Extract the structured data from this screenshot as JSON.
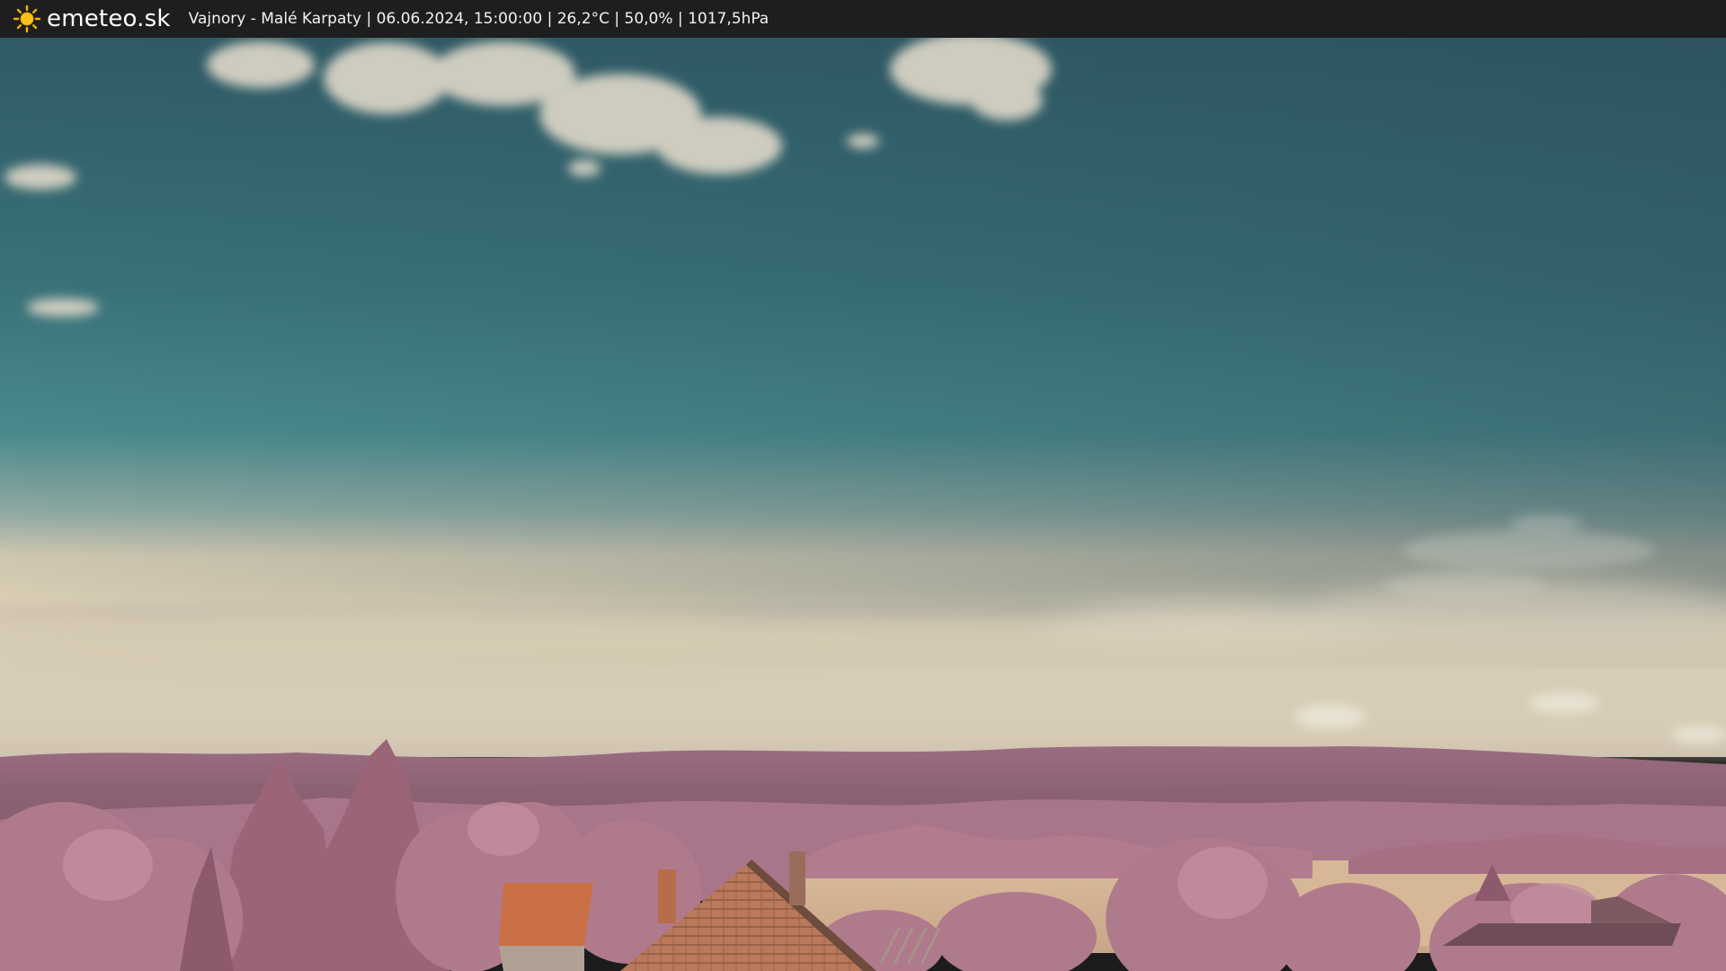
{
  "header": {
    "brand": "emeteo.sk",
    "logo_icon": "sun-icon",
    "location": "Vajnory - Malé Karpaty",
    "datetime": "06.06.2024, 15:00:00",
    "temperature": "26,2°C",
    "humidity": "50,0%",
    "pressure": "1017,5hPa",
    "separator": " | "
  },
  "colors": {
    "topbar": "#1e1e1e",
    "sun": "#f5b400",
    "sky_top": "#2f5c66",
    "sky_mid": "#3f7a80",
    "haze": "#d9cdb4",
    "hills": "#8a5d70",
    "foliage": "#b77d8f",
    "field": "#d8b896",
    "roof": "#c97a4c"
  }
}
